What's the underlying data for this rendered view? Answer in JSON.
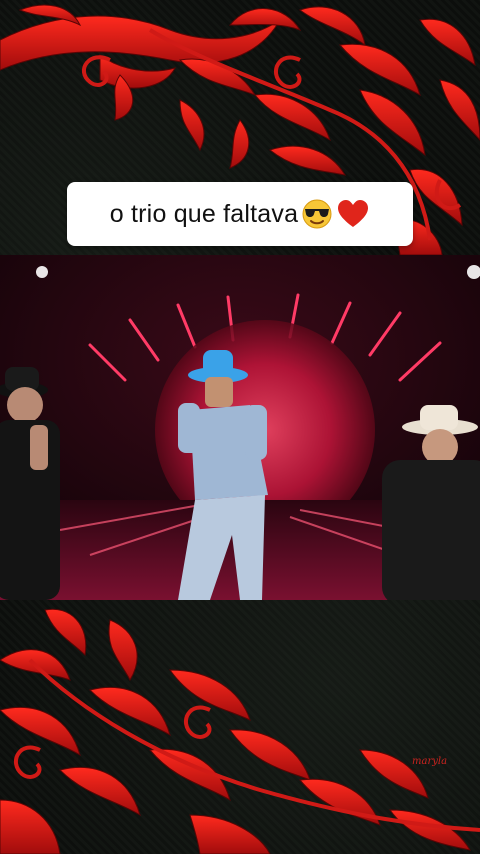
{
  "caption": {
    "text": "o trio que faltava"
  },
  "icons": {
    "sunglasses": "smiling-face-with-sunglasses-emoji",
    "heart": "red-heart-emoji"
  },
  "colors": {
    "ornament_red": "#d81818",
    "ornament_dark": "#8a0c0c",
    "background": "#0d0f0d",
    "caption_bg": "#ffffff"
  },
  "watermark": "maryla"
}
